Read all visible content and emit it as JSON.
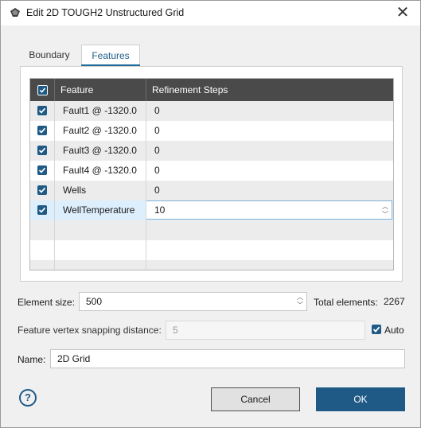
{
  "window": {
    "title": "Edit 2D TOUGH2 Unstructured Grid",
    "close_glyph": "✕"
  },
  "tabs": [
    {
      "label": "Boundary",
      "active": false
    },
    {
      "label": "Features",
      "active": true
    }
  ],
  "grid": {
    "columns": [
      "Feature",
      "Refinement Steps"
    ],
    "header_checked": true,
    "rows": [
      {
        "feature": "Fault1 @ -1320.0",
        "steps": "0",
        "checked": true
      },
      {
        "feature": "Fault2 @ -1320.0",
        "steps": "0",
        "checked": true
      },
      {
        "feature": "Fault3 @ -1320.0",
        "steps": "0",
        "checked": true
      },
      {
        "feature": "Fault4 @ -1320.0",
        "steps": "0",
        "checked": true
      },
      {
        "feature": "Wells",
        "steps": "0",
        "checked": true
      },
      {
        "feature": "WellTemperature",
        "steps": "10",
        "checked": true,
        "selected": true,
        "editing": true
      }
    ]
  },
  "element_size": {
    "label": "Element size:",
    "value": "500"
  },
  "total_elements": {
    "label": "Total elements:",
    "value": "2267"
  },
  "snapping": {
    "label": "Feature vertex snapping distance:",
    "value": "5",
    "disabled": true
  },
  "auto": {
    "label": "Auto",
    "checked": true
  },
  "name": {
    "label": "Name:",
    "value": "2D Grid"
  },
  "buttons": {
    "cancel": "Cancel",
    "ok": "OK",
    "help": "?"
  },
  "colors": {
    "accent": "#1f5a86",
    "header_bg": "#4a4a4a",
    "selected_row": "#ddeefc"
  }
}
